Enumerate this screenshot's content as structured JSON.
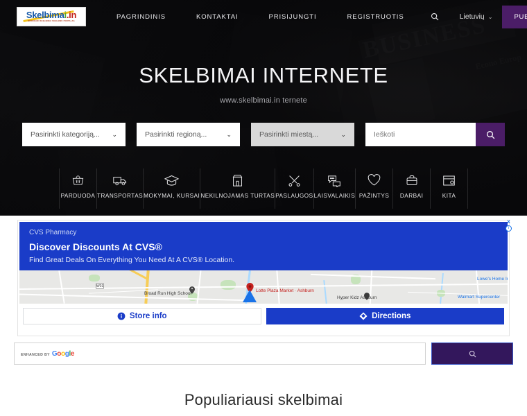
{
  "nav": {
    "logo": {
      "part1": "Skelbima",
      "part_dot": "i",
      "part2": ".in",
      "tagline": "NEMOKAMI SKELBIMAI SKELBIMU PORTALAS"
    },
    "links": [
      {
        "label": "PAGRINDINIS",
        "name": "nav-link-pagrindinis"
      },
      {
        "label": "KONTAKTAI",
        "name": "nav-link-kontaktai"
      },
      {
        "label": "PRISIJUNGTI",
        "name": "nav-link-prisijungti"
      },
      {
        "label": "REGISTRUOTIS",
        "name": "nav-link-registruotis"
      }
    ],
    "search_icon": "search-icon",
    "language": "Lietuvių",
    "language_caret": "⌄",
    "publish_button": "PUBLIKUOTI SKELBIMĄ",
    "accent_color": "#4b1d67"
  },
  "hero": {
    "title": "SKELBIMAI INTERNETE",
    "subtitle": "www.skelbimai.in ternete",
    "bg_word": "BUSINESS",
    "bg_word2": "Econo\nEurop"
  },
  "search": {
    "category": {
      "value": "Pasirinkti kategoriją...",
      "caret": "⌄"
    },
    "region": {
      "value": "Pasirinkti regioną...",
      "caret": "⌄"
    },
    "city": {
      "value": "Pasirinkti miestą...",
      "caret": "⌄",
      "disabled": true
    },
    "input_placeholder": "Ieškoti",
    "input_value": "Ieškoti",
    "button_icon": "search-icon"
  },
  "categories": [
    {
      "label": "PARDUODA",
      "icon": "basket-icon"
    },
    {
      "label": "TRANSPORTAS",
      "icon": "truck-icon"
    },
    {
      "label": "MOKYMAI, KURSAI",
      "icon": "graduation-cap-icon"
    },
    {
      "label": "NEKILNOJAMAS TURTAS",
      "icon": "building-icon"
    },
    {
      "label": "PASLAUGOS",
      "icon": "tools-icon"
    },
    {
      "label": "LAISVALAIKIS",
      "icon": "chat-icon"
    },
    {
      "label": "PAŽINTYS",
      "icon": "heart-icon"
    },
    {
      "label": "DARBAI",
      "icon": "briefcase-icon"
    },
    {
      "label": "KITA",
      "icon": "window-icon"
    }
  ],
  "ad": {
    "brand": "CVS Pharmacy",
    "headline": "Discover Discounts At CVS®",
    "description": "Find Great Deals On Everything You Need At A CVS® Location.",
    "close_icon": "x",
    "info_icon": "i",
    "bg_color": "#1a3cc8",
    "buttons": [
      {
        "label": "Store info",
        "icon": "info-icon",
        "style": "outline"
      },
      {
        "label": "Directions",
        "icon": "directions-icon",
        "style": "filled"
      }
    ],
    "map": {
      "labels": [
        "Broad Run High School",
        "Lotte Plaza Market · Ashburn",
        "Hyper Kidz Ashburn",
        "Lowe's Home Improvement",
        "Walmart Supercenter"
      ],
      "route_shield": "W01"
    }
  },
  "google_search": {
    "enhanced_label": "ENHANCED BY",
    "logo": {
      "g": "G",
      "o1": "o",
      "o2": "o",
      "g2": "g",
      "l": "l",
      "e": "e"
    },
    "value": "",
    "button_icon": "search-icon",
    "button_color": "#33175c"
  },
  "popular": {
    "title": "Populiariausi skelbimai"
  }
}
